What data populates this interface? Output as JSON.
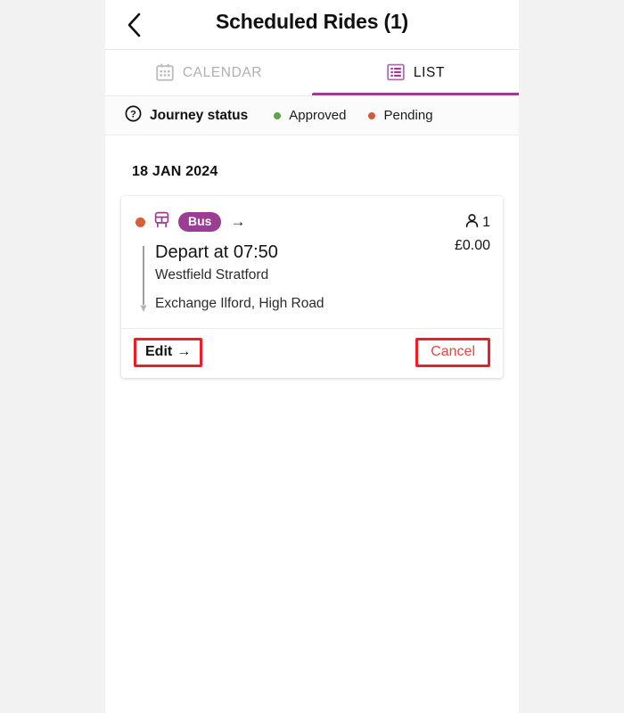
{
  "header": {
    "title": "Scheduled Rides (1)",
    "back_icon": "chevron-left-icon"
  },
  "tabs": [
    {
      "label": "CALENDAR",
      "icon": "calendar-icon",
      "active": false
    },
    {
      "label": "LIST",
      "icon": "list-icon",
      "active": true
    }
  ],
  "status_bar": {
    "help_icon": "question-circle-icon",
    "title": "Journey status",
    "legend": [
      {
        "label": "Approved",
        "color": "#5aa545"
      },
      {
        "label": "Pending",
        "color": "#d4593a"
      }
    ]
  },
  "content": {
    "date_heading": "18 JAN 2024",
    "ride": {
      "status_color": "#d4613a",
      "mode_icon": "bus-icon",
      "mode_label": "Bus",
      "direction_icon": "arrow-right-icon",
      "passenger_icon": "person-icon",
      "passenger_count": "1",
      "price": "£0.00",
      "depart_time": "Depart at 07:50",
      "origin": "Westfield Stratford",
      "destination": "Exchange Ilford, High Road",
      "edit_label": "Edit",
      "edit_arrow": "→",
      "cancel_label": "Cancel"
    }
  },
  "colors": {
    "brand_purple": "#9b3d93",
    "annotation_red": "#f11d26",
    "cancel_text": "#e8473f"
  }
}
